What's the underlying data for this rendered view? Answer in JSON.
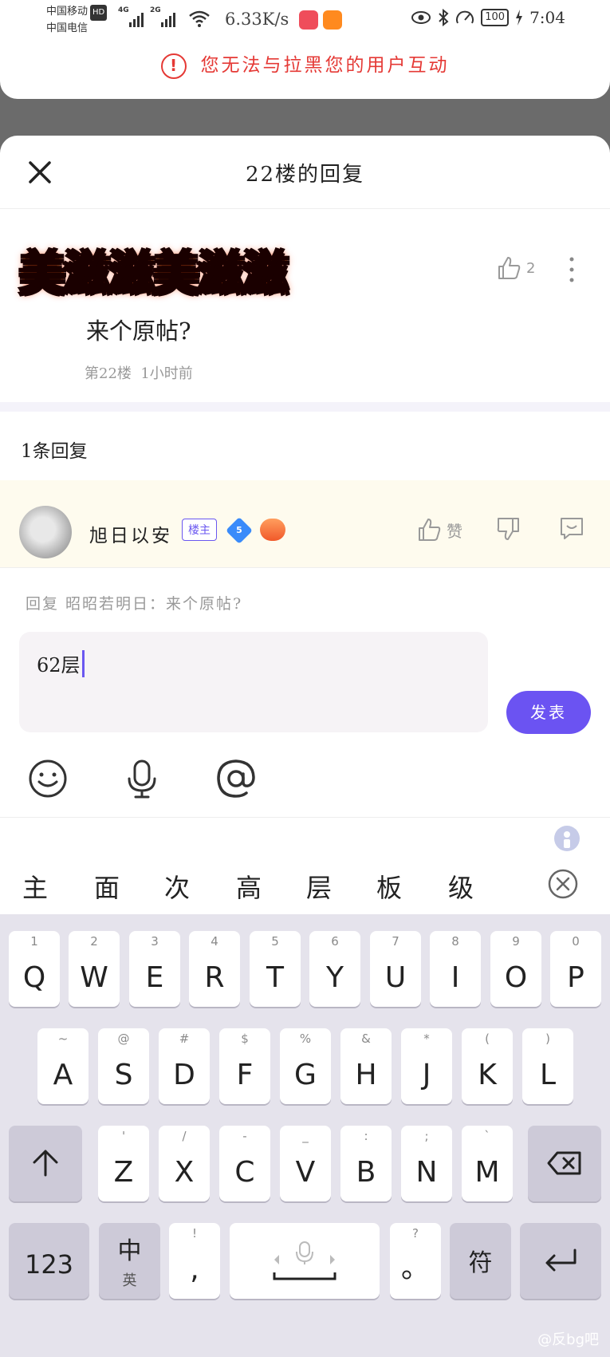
{
  "status_bar": {
    "carrier_1": "中国移动",
    "carrier_1_badge": "HD",
    "carrier_2": "中国电信",
    "signal_1_tag": "4G",
    "signal_2_tag": "2G",
    "net_speed": "6.33K/s",
    "battery": "100",
    "time": "7:04"
  },
  "toast": {
    "message": "您无法与拉黑您的用户互动"
  },
  "sheet": {
    "title": "22楼的回复"
  },
  "post": {
    "sticker_text": "美滋滋美滋滋",
    "text": "来个原帖?",
    "meta_floor": "第22楼",
    "meta_time": "1小时前",
    "like_count": "2"
  },
  "reply_count_label": "1条回复",
  "reply": {
    "username": "旭日以安",
    "owner_badge": "楼主",
    "level": "5",
    "like_label": "赞"
  },
  "reply_hint": "回复 昭昭若明日：来个原帖?",
  "composer": {
    "input_value": "62层",
    "post_button": "发表"
  },
  "ime": {
    "candidates": [
      "主",
      "面",
      "次",
      "高",
      "层",
      "板",
      "级"
    ]
  },
  "keyboard": {
    "row1": [
      {
        "main": "Q",
        "sub": "1"
      },
      {
        "main": "W",
        "sub": "2"
      },
      {
        "main": "E",
        "sub": "3"
      },
      {
        "main": "R",
        "sub": "4"
      },
      {
        "main": "T",
        "sub": "5"
      },
      {
        "main": "Y",
        "sub": "6"
      },
      {
        "main": "U",
        "sub": "7"
      },
      {
        "main": "I",
        "sub": "8"
      },
      {
        "main": "O",
        "sub": "9"
      },
      {
        "main": "P",
        "sub": "0"
      }
    ],
    "row2": [
      {
        "main": "A",
        "sub": "~"
      },
      {
        "main": "S",
        "sub": "@"
      },
      {
        "main": "D",
        "sub": "#"
      },
      {
        "main": "F",
        "sub": "$"
      },
      {
        "main": "G",
        "sub": "%"
      },
      {
        "main": "H",
        "sub": "&"
      },
      {
        "main": "J",
        "sub": "*"
      },
      {
        "main": "K",
        "sub": "("
      },
      {
        "main": "L",
        "sub": ")"
      }
    ],
    "row3": [
      {
        "main": "Z",
        "sub": "'"
      },
      {
        "main": "X",
        "sub": "/"
      },
      {
        "main": "C",
        "sub": "-"
      },
      {
        "main": "V",
        "sub": "_"
      },
      {
        "main": "B",
        "sub": ":"
      },
      {
        "main": "N",
        "sub": ";"
      },
      {
        "main": "M",
        "sub": "`"
      }
    ],
    "num_key": "123",
    "lang_key_main": "中",
    "lang_key_sub": "英",
    "comma_key": ",",
    "comma_sub": "!",
    "period_key": "。",
    "period_sub": "?",
    "symbol_key": "符"
  },
  "attribution": "@反bg吧",
  "colors": {
    "accent": "#6b53f2",
    "warning": "#e53935",
    "reply_bg": "#fefbee"
  },
  "icons": {
    "close": "close-icon",
    "like": "thumb-up-icon",
    "dislike": "thumb-down-icon",
    "comment": "comment-icon",
    "more": "more-vertical-icon",
    "emoji": "emoji-icon",
    "mic": "mic-icon",
    "at": "at-icon",
    "shift": "shift-icon",
    "backspace": "backspace-icon",
    "enter": "enter-icon"
  }
}
